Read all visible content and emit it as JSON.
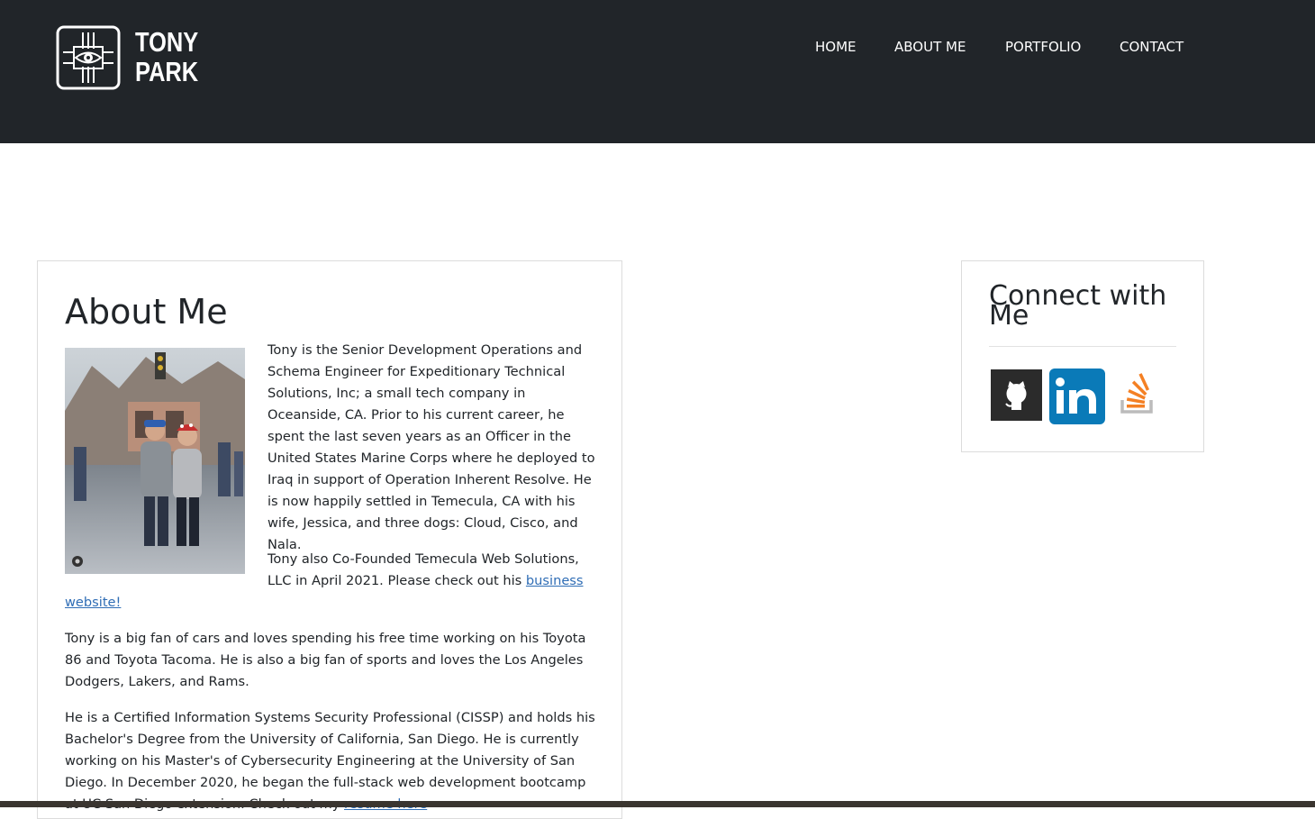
{
  "brand": {
    "line1": "TONY",
    "line2": "PARK",
    "logo_icon": "eye-circuit-logo"
  },
  "nav": {
    "items": [
      "HOME",
      "ABOUT ME",
      "PORTFOLIO",
      "CONTACT"
    ]
  },
  "about": {
    "title": "About Me",
    "photo_icon": "couple-photo",
    "p1": "Tony is the Senior Development Operations and Schema Engineer for Expeditionary Technical Solutions, Inc; a small tech company in Oceanside, CA. Prior to his current career, he spent the last seven years as an Officer in the United States Marine Corps where he deployed to Iraq in support of Operation Inherent Resolve. He is now happily settled in Temecula, CA with his wife, Jessica, and three dogs: Cloud, Cisco, and Nala.",
    "p2_text": "Tony also Co-Founded Temecula Web Solutions, LLC in April 2021. Please check out his ",
    "p2_link_a": "business",
    "p2_link_b": "website!",
    "p3": "Tony is a big fan of cars and loves spending his free time working on his Toyota 86 and Toyota Tacoma. He is also a big fan of sports and loves the Los Angeles Dodgers, Lakers, and Rams.",
    "p4_text": "He is a Certified Information Systems Security Professional (CISSP) and holds his Bachelor's Degree from the University of California, San Diego. He is currently working on his Master's of Cybersecurity Engineering at the University of San Diego. In December 2020, he began the full-stack web development bootcamp at UC San Diego extension. Check out my ",
    "p4_link": "resume here"
  },
  "connect": {
    "title": "Connect with Me",
    "icons": [
      "github-icon",
      "linkedin-icon",
      "stackoverflow-icon"
    ],
    "linkedin_color": "#0a7ab8",
    "stackoverflow_color": "#f48024"
  },
  "colors": {
    "header_bg": "#212529",
    "link": "#2f6db5"
  }
}
